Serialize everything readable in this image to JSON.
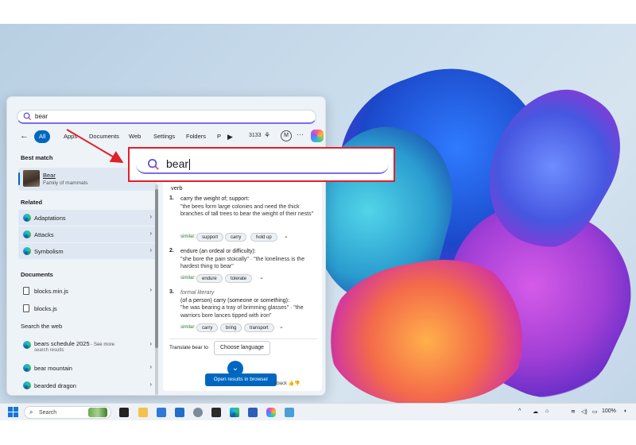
{
  "search": {
    "query": "bear"
  },
  "filters": {
    "tabs": [
      "All",
      "Apps",
      "Documents",
      "Web",
      "Settings",
      "Folders",
      "P"
    ],
    "points": "3133",
    "account_initial": "M"
  },
  "best_match": {
    "heading": "Best match",
    "title": "Bear",
    "subtitle": "Family of mammals"
  },
  "related": {
    "heading": "Related",
    "items": [
      "Adaptations",
      "Attacks",
      "Symbolism"
    ]
  },
  "documents": {
    "heading": "Documents",
    "items": [
      "blocks.min.js",
      "blocks.js"
    ]
  },
  "web": {
    "heading": "Search the web",
    "items": [
      {
        "label": "bears schedule 2025",
        "more": " - See more",
        "sub": "search results"
      },
      {
        "label": "bear mountain"
      },
      {
        "label": "bearded dragon"
      }
    ]
  },
  "dictionary": {
    "pos": "verb",
    "defs": [
      {
        "num": "1.",
        "meaning": "carry the weight of; support:",
        "example": "\"the bees form large colonies and need the thick branches of tall trees to bear the weight of their nests\"",
        "similar_label": "similar:",
        "similar": [
          "support",
          "carry",
          "hold up"
        ]
      },
      {
        "num": "2.",
        "meaning": "endure (an ordeal or difficulty):",
        "example": "\"she bore the pain stoically\" · \"the loneliness is the hardest thing to bear\"",
        "similar_label": "similar:",
        "similar": [
          "endure",
          "tolerate"
        ]
      },
      {
        "num": "3.",
        "register": "formal literary",
        "meaning": "(of a person) carry (someone or something):",
        "example": "\"he was bearing a tray of brimming glasses\" · \"the warriors bore lances tipped with iron\"",
        "similar_label": "similar:",
        "similar": [
          "carry",
          "bring",
          "transport"
        ]
      }
    ],
    "translate_label": "Translate bear to",
    "translate_button": "Choose language",
    "open_button": "Open results in browser",
    "feedback": "dback"
  },
  "zoom": {
    "query": "bear"
  },
  "taskbar": {
    "search_placeholder": "Search",
    "battery": "100%"
  },
  "colors": {
    "accent": "#0067c0",
    "callout_red": "#e0202a",
    "copilot_purple": "#7a6ee6"
  }
}
